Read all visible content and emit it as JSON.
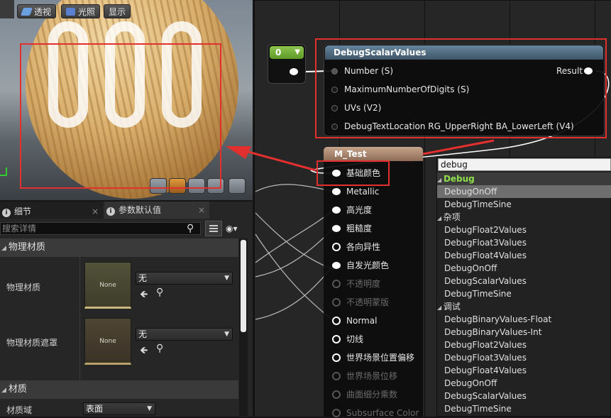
{
  "viewport": {
    "buttons": [
      {
        "label": "透视",
        "icon": "perspective-icon"
      },
      {
        "label": "光照",
        "icon": "lighting-cube-icon"
      },
      {
        "label": "显示",
        "icon": ""
      }
    ],
    "preview_digits": "000",
    "bottom_icons": [
      "cylinder-icon",
      "sphere-icon",
      "plane-icon",
      "cube-icon",
      "teapot-icon"
    ]
  },
  "details_panel": {
    "tabs": [
      {
        "label": "细节",
        "icon": "info-icon"
      },
      {
        "label": "参数默认值",
        "icon": "info-icon"
      }
    ],
    "search_placeholder": "搜索详情",
    "sections": [
      {
        "title": "物理材质",
        "rows": [
          {
            "label": "物理材质",
            "thumb": "None",
            "value": "无"
          },
          {
            "label": "物理材质遮罩",
            "thumb": "None",
            "value": "无"
          }
        ]
      },
      {
        "title": "材质",
        "rows": [
          {
            "label": "材质域",
            "value": "表面"
          }
        ]
      }
    ]
  },
  "graph": {
    "constant_node": {
      "value": "0"
    },
    "debug_node": {
      "title": "DebugScalarValues",
      "inputs": [
        "Number (S)",
        "MaximumNumberOfDigits (S)",
        "UVs (V2)",
        "DebugTextLocation RG_UpperRight BA_LowerLeft (V4)"
      ],
      "output": "Result"
    },
    "material_node": {
      "title": "M_Test",
      "pins": [
        {
          "label": "基础颜色",
          "state": "connected"
        },
        {
          "label": "Metallic",
          "state": "filled"
        },
        {
          "label": "高光度",
          "state": "filled"
        },
        {
          "label": "粗糙度",
          "state": "filled"
        },
        {
          "label": "各向异性",
          "state": "hollow"
        },
        {
          "label": "自发光颜色",
          "state": "filled"
        },
        {
          "label": "不透明度",
          "state": "disabled"
        },
        {
          "label": "不透明蒙版",
          "state": "disabled"
        },
        {
          "label": "Normal",
          "state": "hollow"
        },
        {
          "label": "切线",
          "state": "hollow"
        },
        {
          "label": "世界场景位置偏移",
          "state": "hollow"
        },
        {
          "label": "世界场景位移",
          "state": "disabled"
        },
        {
          "label": "曲面细分乘数",
          "state": "disabled"
        },
        {
          "label": "Subsurface Color",
          "state": "disabled"
        }
      ]
    }
  },
  "context_menu": {
    "search_value": "debug",
    "items": [
      {
        "label": "Debug",
        "kind": "category-highlight"
      },
      {
        "label": "DebugOnOff",
        "kind": "selected"
      },
      {
        "label": "DebugTimeSine",
        "kind": "item"
      },
      {
        "label": "杂项",
        "kind": "category"
      },
      {
        "label": "DebugFloat2Values",
        "kind": "item"
      },
      {
        "label": "DebugFloat3Values",
        "kind": "item"
      },
      {
        "label": "DebugFloat4Values",
        "kind": "item"
      },
      {
        "label": "DebugOnOff",
        "kind": "item"
      },
      {
        "label": "DebugScalarValues",
        "kind": "item"
      },
      {
        "label": "DebugTimeSine",
        "kind": "item"
      },
      {
        "label": "调试",
        "kind": "category"
      },
      {
        "label": "DebugBinaryValues-Float",
        "kind": "item"
      },
      {
        "label": "DebugBinaryValues-Int",
        "kind": "item"
      },
      {
        "label": "DebugFloat2Values",
        "kind": "item"
      },
      {
        "label": "DebugFloat3Values",
        "kind": "item"
      },
      {
        "label": "DebugFloat4Values",
        "kind": "item"
      },
      {
        "label": "DebugOnOff",
        "kind": "item"
      },
      {
        "label": "DebugScalarValues",
        "kind": "item"
      },
      {
        "label": "DebugTimeSine",
        "kind": "item"
      }
    ]
  },
  "colors": {
    "annotation_red": "#e2302f",
    "constant_header": "#7ab83f",
    "function_header": "#5a7890",
    "material_header": "#a98470",
    "menu_category_green": "#8fe04a"
  }
}
